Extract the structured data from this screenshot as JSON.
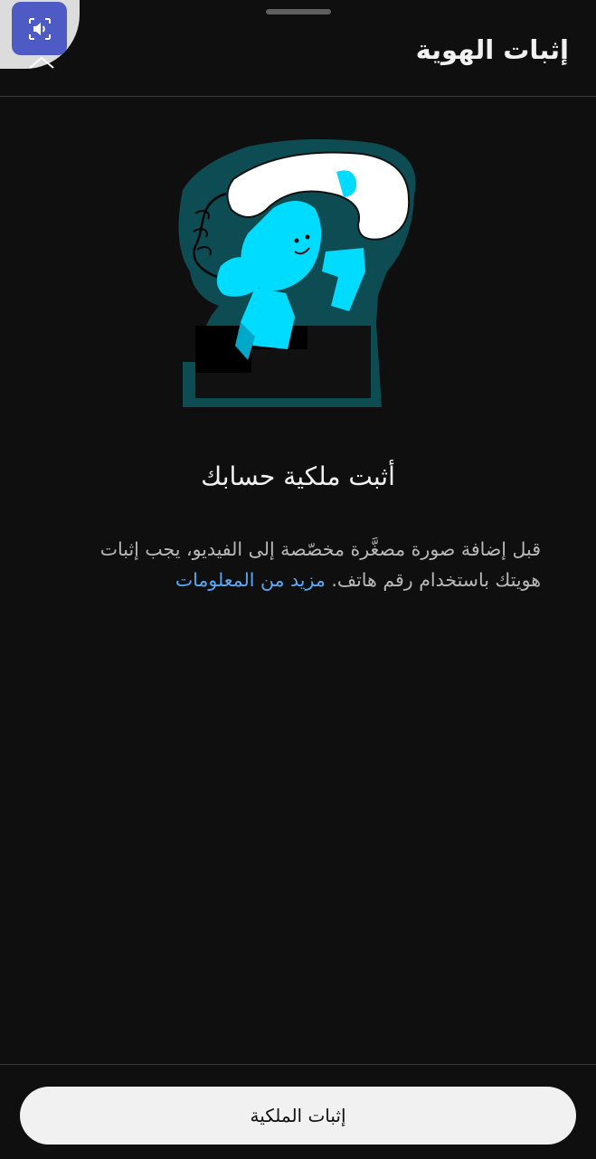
{
  "header": {
    "title": "إثبات الهوية"
  },
  "overlay": {
    "icon": "speaker-icon",
    "accent_color": "#4e5bc4"
  },
  "main": {
    "illustration": "phone-call-character-illustration",
    "headline": "أثبت ملكية حسابك",
    "body": "قبل إضافة صورة مصغَّرة مخصّصة إلى الفيديو، يجب إثبات هويتك باستخدام رقم هاتف.",
    "learn_more": "مزيد من المعلومات",
    "link_color": "#5aa9f5"
  },
  "footer": {
    "verify_label": "إثبات الملكية"
  }
}
